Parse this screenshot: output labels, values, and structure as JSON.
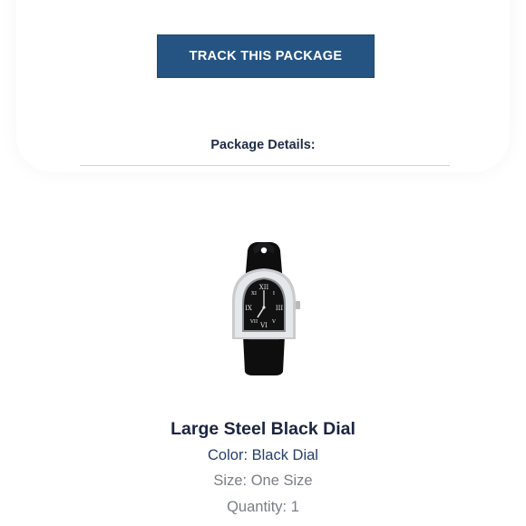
{
  "actions": {
    "track_label": "TRACK THIS PACKAGE"
  },
  "package": {
    "section_title": "Package Details:"
  },
  "item": {
    "name": "Large Steel Black Dial",
    "color_line": "Color: Black Dial",
    "size_line": "Size: One Size",
    "quantity_line": "Quantity: 1",
    "image_icon": "watch-product-image"
  },
  "colors": {
    "button_bg": "#265482",
    "title_text": "#1c2540",
    "accent_text": "#27406a",
    "muted_text": "#7a7e86",
    "divider": "#cfd2d6"
  }
}
